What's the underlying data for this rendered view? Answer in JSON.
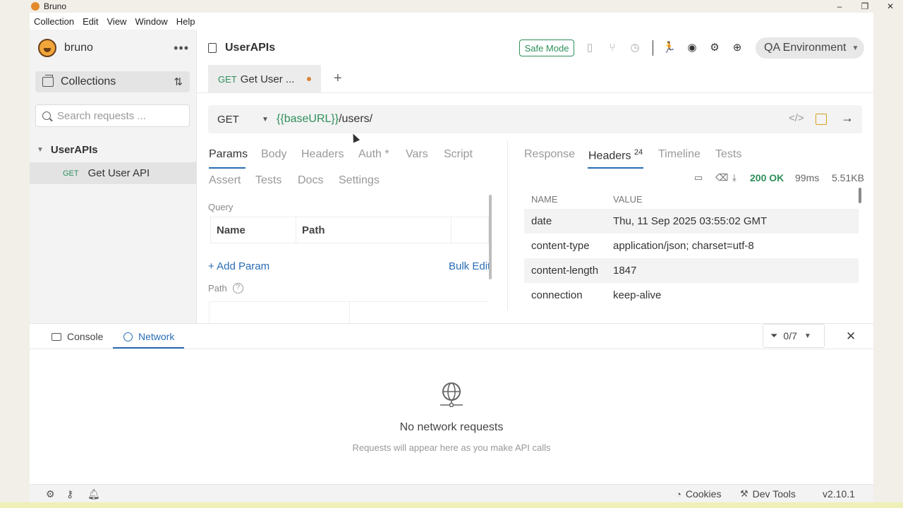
{
  "window": {
    "title": "Bruno",
    "controls": {
      "minimize": "–",
      "maximize": "❐",
      "close": "✕"
    }
  },
  "menu": [
    "Collection",
    "Edit",
    "View",
    "Window",
    "Help"
  ],
  "sidebar": {
    "brand": "bruno",
    "more_label": "•••",
    "collections_label": "Collections",
    "sort_icon": "⇅",
    "search_placeholder": "Search requests ...",
    "collection": {
      "name": "UserAPIs",
      "chevron": "▼"
    },
    "requests": [
      {
        "method": "GET",
        "name": "Get User API"
      }
    ]
  },
  "header": {
    "collection_title": "UserAPIs",
    "safe_mode": "Safe Mode",
    "environment": "QA Environment",
    "icons": [
      "file-code-icon",
      "git-branch-icon",
      "history-icon",
      "runner-icon",
      "eye-icon",
      "gear-icon",
      "globe-icon"
    ]
  },
  "tabs": {
    "open": [
      {
        "method": "GET",
        "name": "Get User ..."
      }
    ],
    "add_label": "+"
  },
  "request": {
    "method": "GET",
    "url_variable": "{{baseURL}}",
    "url_path": "/users/",
    "tabs_row1": [
      "Params",
      "Body",
      "Headers",
      "Auth *",
      "Vars",
      "Script"
    ],
    "tabs_row2": [
      "Assert",
      "Tests",
      "Docs",
      "Settings"
    ],
    "active_tab": "Params",
    "query_label": "Query",
    "param_columns": [
      "Name",
      "Path",
      ""
    ],
    "add_param": "+ Add Param",
    "bulk_edit": "Bulk Edit",
    "path_label": "Path",
    "help_glyph": "?"
  },
  "response": {
    "tabs": [
      "Response",
      "Headers",
      "Timeline",
      "Tests"
    ],
    "active_tab": "Headers",
    "headers_count": "24",
    "status": "200 OK",
    "time": "99ms",
    "size": "5.51KB",
    "columns": [
      "NAME",
      "VALUE"
    ],
    "headers": [
      {
        "name": "date",
        "value": "Thu, 11 Sep 2025 03:55:02 GMT"
      },
      {
        "name": "content-type",
        "value": "application/json; charset=utf-8"
      },
      {
        "name": "content-length",
        "value": "1847"
      },
      {
        "name": "connection",
        "value": "keep-alive"
      }
    ]
  },
  "panel": {
    "tabs": [
      "Console",
      "Network"
    ],
    "active_tab": "Network",
    "filter_count": "0/7",
    "empty_title": "No network requests",
    "empty_subtitle": "Requests will appear here as you make API calls"
  },
  "statusbar": {
    "cookies": "Cookies",
    "dev_tools": "Dev Tools",
    "version": "v2.10.1"
  },
  "colors": {
    "accent_blue": "#2a6db5",
    "method_green": "#2f8f5b",
    "unsaved_dot": "#d8823a",
    "save_icon": "#d4a21a"
  }
}
